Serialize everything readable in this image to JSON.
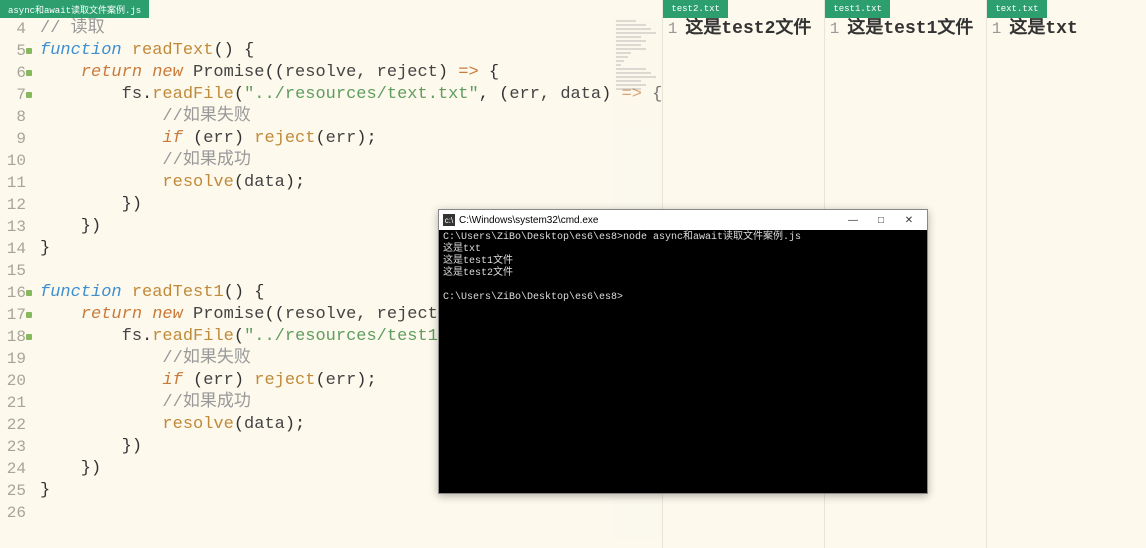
{
  "panes": {
    "main": {
      "tab": "async和await读取文件案例.js",
      "lines": [
        {
          "n": 4,
          "mod": false,
          "tokens": [
            [
              "c-comment",
              "// 读取"
            ]
          ]
        },
        {
          "n": 5,
          "mod": true,
          "tokens": [
            [
              "c-keyword",
              "function "
            ],
            [
              "c-func",
              "readText"
            ],
            [
              "c-paren",
              "() {"
            ]
          ]
        },
        {
          "n": 6,
          "mod": true,
          "tokens": [
            [
              "c-paren",
              "    "
            ],
            [
              "c-keyword2",
              "return new "
            ],
            [
              "c-id",
              "Promise"
            ],
            [
              "c-paren",
              "(("
            ],
            [
              "c-id",
              "resolve, reject"
            ],
            [
              "c-paren",
              ") "
            ],
            [
              "c-keyword2",
              "=>"
            ],
            [
              "c-paren",
              " {"
            ]
          ]
        },
        {
          "n": 7,
          "mod": true,
          "tokens": [
            [
              "c-paren",
              "        "
            ],
            [
              "c-id",
              "fs"
            ],
            [
              "c-paren",
              "."
            ],
            [
              "c-func",
              "readFile"
            ],
            [
              "c-paren",
              "("
            ],
            [
              "c-str",
              "\"../resources/text.txt\""
            ],
            [
              "c-paren",
              ", ("
            ],
            [
              "c-id",
              "err, data"
            ],
            [
              "c-paren",
              ") "
            ],
            [
              "c-keyword2",
              "=>"
            ],
            [
              "c-paren",
              " {"
            ]
          ]
        },
        {
          "n": 8,
          "mod": false,
          "tokens": [
            [
              "c-paren",
              "            "
            ],
            [
              "c-comment",
              "//如果失败"
            ]
          ]
        },
        {
          "n": 9,
          "mod": false,
          "tokens": [
            [
              "c-paren",
              "            "
            ],
            [
              "c-keyword2",
              "if "
            ],
            [
              "c-paren",
              "("
            ],
            [
              "c-id",
              "err"
            ],
            [
              "c-paren",
              ") "
            ],
            [
              "c-func",
              "reject"
            ],
            [
              "c-paren",
              "("
            ],
            [
              "c-id",
              "err"
            ],
            [
              "c-paren",
              ");"
            ]
          ]
        },
        {
          "n": 10,
          "mod": false,
          "tokens": [
            [
              "c-paren",
              "            "
            ],
            [
              "c-comment",
              "//如果成功"
            ]
          ]
        },
        {
          "n": 11,
          "mod": false,
          "tokens": [
            [
              "c-paren",
              "            "
            ],
            [
              "c-func",
              "resolve"
            ],
            [
              "c-paren",
              "("
            ],
            [
              "c-id",
              "data"
            ],
            [
              "c-paren",
              ");"
            ]
          ]
        },
        {
          "n": 12,
          "mod": false,
          "tokens": [
            [
              "c-paren",
              "        })"
            ]
          ]
        },
        {
          "n": 13,
          "mod": false,
          "tokens": [
            [
              "c-paren",
              "    })"
            ]
          ]
        },
        {
          "n": 14,
          "mod": false,
          "tokens": [
            [
              "c-paren",
              "}"
            ]
          ]
        },
        {
          "n": 15,
          "mod": false,
          "tokens": []
        },
        {
          "n": 16,
          "mod": true,
          "tokens": [
            [
              "c-keyword",
              "function "
            ],
            [
              "c-func",
              "readTest1"
            ],
            [
              "c-paren",
              "() {"
            ]
          ]
        },
        {
          "n": 17,
          "mod": true,
          "tokens": [
            [
              "c-paren",
              "    "
            ],
            [
              "c-keyword2",
              "return new "
            ],
            [
              "c-id",
              "Promise"
            ],
            [
              "c-paren",
              "(("
            ],
            [
              "c-id",
              "resolve, reject"
            ],
            [
              "c-paren",
              ")"
            ]
          ]
        },
        {
          "n": 18,
          "mod": true,
          "tokens": [
            [
              "c-paren",
              "        "
            ],
            [
              "c-id",
              "fs"
            ],
            [
              "c-paren",
              "."
            ],
            [
              "c-func",
              "readFile"
            ],
            [
              "c-paren",
              "("
            ],
            [
              "c-str",
              "\"../resources/test1."
            ]
          ]
        },
        {
          "n": 19,
          "mod": false,
          "tokens": [
            [
              "c-paren",
              "            "
            ],
            [
              "c-comment",
              "//如果失败"
            ]
          ]
        },
        {
          "n": 20,
          "mod": false,
          "tokens": [
            [
              "c-paren",
              "            "
            ],
            [
              "c-keyword2",
              "if "
            ],
            [
              "c-paren",
              "("
            ],
            [
              "c-id",
              "err"
            ],
            [
              "c-paren",
              ") "
            ],
            [
              "c-func",
              "reject"
            ],
            [
              "c-paren",
              "("
            ],
            [
              "c-id",
              "err"
            ],
            [
              "c-paren",
              ");"
            ]
          ]
        },
        {
          "n": 21,
          "mod": false,
          "tokens": [
            [
              "c-paren",
              "            "
            ],
            [
              "c-comment",
              "//如果成功"
            ]
          ]
        },
        {
          "n": 22,
          "mod": false,
          "tokens": [
            [
              "c-paren",
              "            "
            ],
            [
              "c-func",
              "resolve"
            ],
            [
              "c-paren",
              "("
            ],
            [
              "c-id",
              "data"
            ],
            [
              "c-paren",
              ");"
            ]
          ]
        },
        {
          "n": 23,
          "mod": false,
          "tokens": [
            [
              "c-paren",
              "        })"
            ]
          ]
        },
        {
          "n": 24,
          "mod": false,
          "tokens": [
            [
              "c-paren",
              "    })"
            ]
          ]
        },
        {
          "n": 25,
          "mod": false,
          "tokens": [
            [
              "c-paren",
              "}"
            ]
          ]
        },
        {
          "n": 26,
          "mod": false,
          "tokens": []
        }
      ]
    },
    "p2": {
      "tab": "test2.txt",
      "line_num": "1",
      "content": "这是test2文件"
    },
    "p3": {
      "tab": "test1.txt",
      "line_num": "1",
      "content": "这是test1文件"
    },
    "p4": {
      "tab": "text.txt",
      "line_num": "1",
      "content": "这是txt"
    }
  },
  "console": {
    "title": "C:\\Windows\\system32\\cmd.exe",
    "lines": [
      "C:\\Users\\ZiBo\\Desktop\\es6\\es8>node async和await读取文件案例.js",
      "这是txt",
      "这是test1文件",
      "这是test2文件",
      "",
      "C:\\Users\\ZiBo\\Desktop\\es6\\es8>"
    ],
    "btn_min": "—",
    "btn_max": "□",
    "btn_close": "✕"
  }
}
